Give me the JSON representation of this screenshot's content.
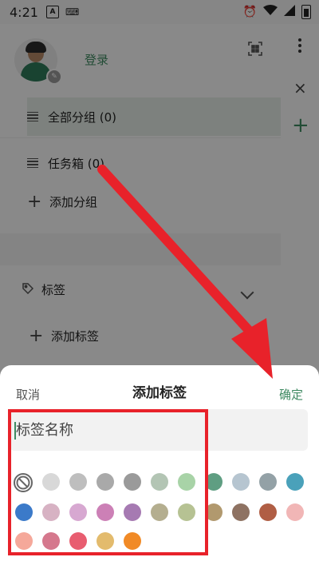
{
  "status_bar": {
    "time": "4:21",
    "a_icon": "A"
  },
  "drawer": {
    "login": "登录",
    "groups": [
      {
        "label": "全部分组 (0)",
        "icon": "list-icon",
        "selected": true
      },
      {
        "label": "任务箱 (0)",
        "icon": "list-icon",
        "selected": false
      }
    ],
    "add_group": "添加分组",
    "tags_header": "标签",
    "add_tag": "添加标签"
  },
  "behind": {
    "close": "×",
    "plus": "+"
  },
  "sheet": {
    "cancel": "取消",
    "title": "添加标签",
    "confirm": "确定",
    "input_placeholder": "标签名称"
  },
  "colors": [
    "#d8d8d8",
    "#bebebe",
    "#a9a9a9",
    "#9a9a9a",
    "#b3c5b4",
    "#a8d3a7",
    "#5f9e82",
    "#b6c5d0",
    "#93a1a6",
    "#4aa1ba",
    "#3b7ac9",
    "#d7b2c3",
    "#d7a8d1",
    "#cc80b6",
    "#a67ab2",
    "#b4ae8f",
    "#b6c293",
    "#b1996e",
    "#8e7262",
    "#b05e44",
    "#f1b6b6",
    "#f5a89a",
    "#d5788d",
    "#e85d70",
    "#e3bb6d",
    "#f18a26"
  ],
  "accent": "#3f8a62"
}
